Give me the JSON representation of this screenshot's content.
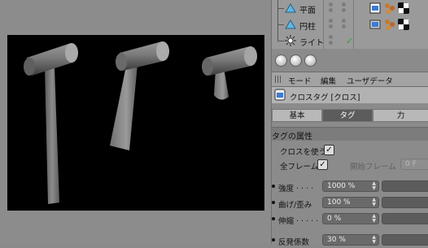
{
  "objects": [
    {
      "name": "平面",
      "icon": "plane-icon"
    },
    {
      "name": "円柱",
      "icon": "cylinder-icon"
    },
    {
      "name": "ライト",
      "icon": "light-icon"
    }
  ],
  "attributes": {
    "menu": [
      "モード",
      "編集",
      "ユーザデータ"
    ],
    "tag_title": "クロスタグ [クロス]",
    "tabs": [
      "基本",
      "タグ",
      "力"
    ],
    "active_tab": "タグ",
    "section": "タグの属性",
    "use_cloth_label": "クロスを使う",
    "use_cloth_checked": true,
    "all_frames_label": "全フレーム",
    "all_frames_checked": true,
    "start_frame_label": "開始フレーム",
    "start_frame_value": "0 F",
    "params": [
      {
        "label": "強度",
        "dots": ". . . .",
        "value": "1000 %"
      },
      {
        "label": "曲げ/歪み",
        "dots": "",
        "value": "100 %"
      },
      {
        "label": "伸縮",
        "dots": ". . . . .",
        "value": "0 %"
      },
      {
        "label": "反発係数",
        "dots": "",
        "value": "30 %"
      }
    ]
  },
  "colors": {
    "viewport_bg": "#000000",
    "panel_bg": "#8d8d8d",
    "active_tab": "#5c5c5c",
    "check_green": "#2c9e3b"
  }
}
